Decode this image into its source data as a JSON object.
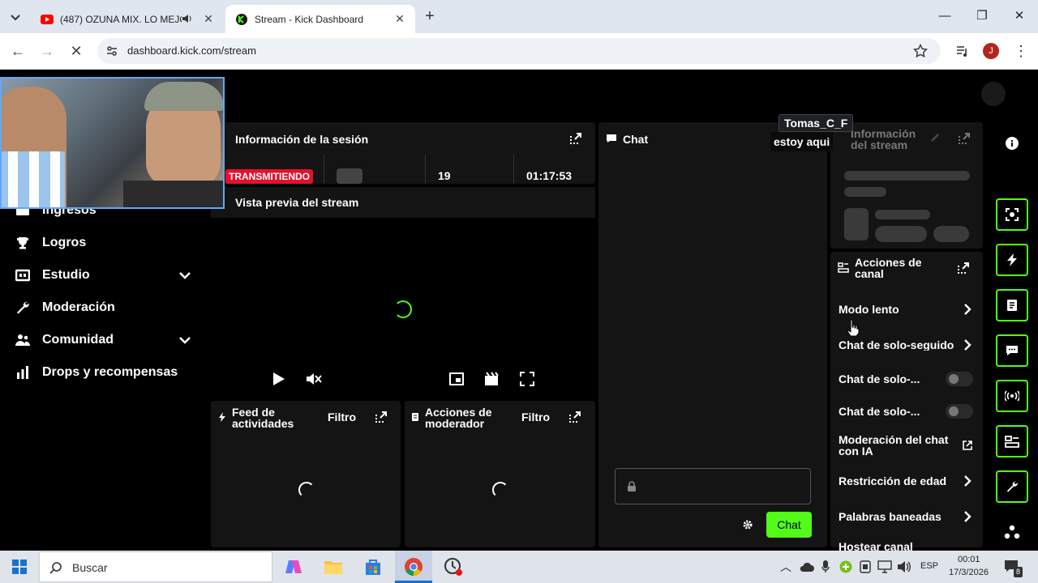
{
  "browser": {
    "tabs": [
      {
        "title": "(487) OZUNA MIX. LO MEJO",
        "active": false
      },
      {
        "title": "Stream - Kick Dashboard",
        "active": true
      }
    ],
    "url": "dashboard.kick.com/stream",
    "profile_initial": "J"
  },
  "overlay": {
    "viewer_name": "Tomas_C_F",
    "chat_message": "estoy aqui"
  },
  "sidebar": {
    "items": [
      {
        "label": "Ingresos",
        "icon": "income-icon"
      },
      {
        "label": "Logros",
        "icon": "trophy-icon"
      },
      {
        "label": "Estudio",
        "icon": "studio-icon",
        "expandable": true
      },
      {
        "label": "Moderación",
        "icon": "wrench-icon"
      },
      {
        "label": "Comunidad",
        "icon": "community-icon",
        "expandable": true
      },
      {
        "label": "Drops y recompensas",
        "icon": "drops-icon"
      }
    ]
  },
  "session": {
    "title": "Información de la sesión",
    "status": "TRANSMITIENDO",
    "viewers": "19",
    "duration": "01:17:53"
  },
  "preview": {
    "title": "Vista previa del stream"
  },
  "feed": {
    "title_line1": "Feed de",
    "title_line2": "actividades",
    "filter": "Filtro"
  },
  "modactions": {
    "title_line1": "Acciones de",
    "title_line2": "moderador",
    "filter": "Filtro"
  },
  "chat": {
    "title": "Chat",
    "send_label": "Chat"
  },
  "stream_info": {
    "title_line1": "Información",
    "title_line2": "del stream"
  },
  "channel_actions": {
    "title_line1": "Acciones de",
    "title_line2": "canal",
    "rows": [
      {
        "label": "Modo lento",
        "kind": "chevron"
      },
      {
        "label": "Chat de solo-seguido",
        "kind": "chevron"
      },
      {
        "label": "Chat de solo-...",
        "kind": "toggle"
      },
      {
        "label": "Chat de solo-...",
        "kind": "toggle"
      },
      {
        "label": "Moderación del chat",
        "label2": "con IA",
        "kind": "external"
      },
      {
        "label": "Restricción de edad",
        "kind": "chevron"
      },
      {
        "label": "Palabras baneadas",
        "kind": "chevron"
      },
      {
        "label": "Hostear canal",
        "kind": "chevron"
      }
    ]
  },
  "colors": {
    "accent": "#53fc18",
    "live": "#e5102b"
  },
  "taskbar": {
    "search_placeholder": "Buscar",
    "lang": "ESP",
    "time": "00:01",
    "date": "17/3/2026",
    "notifications": "8"
  }
}
